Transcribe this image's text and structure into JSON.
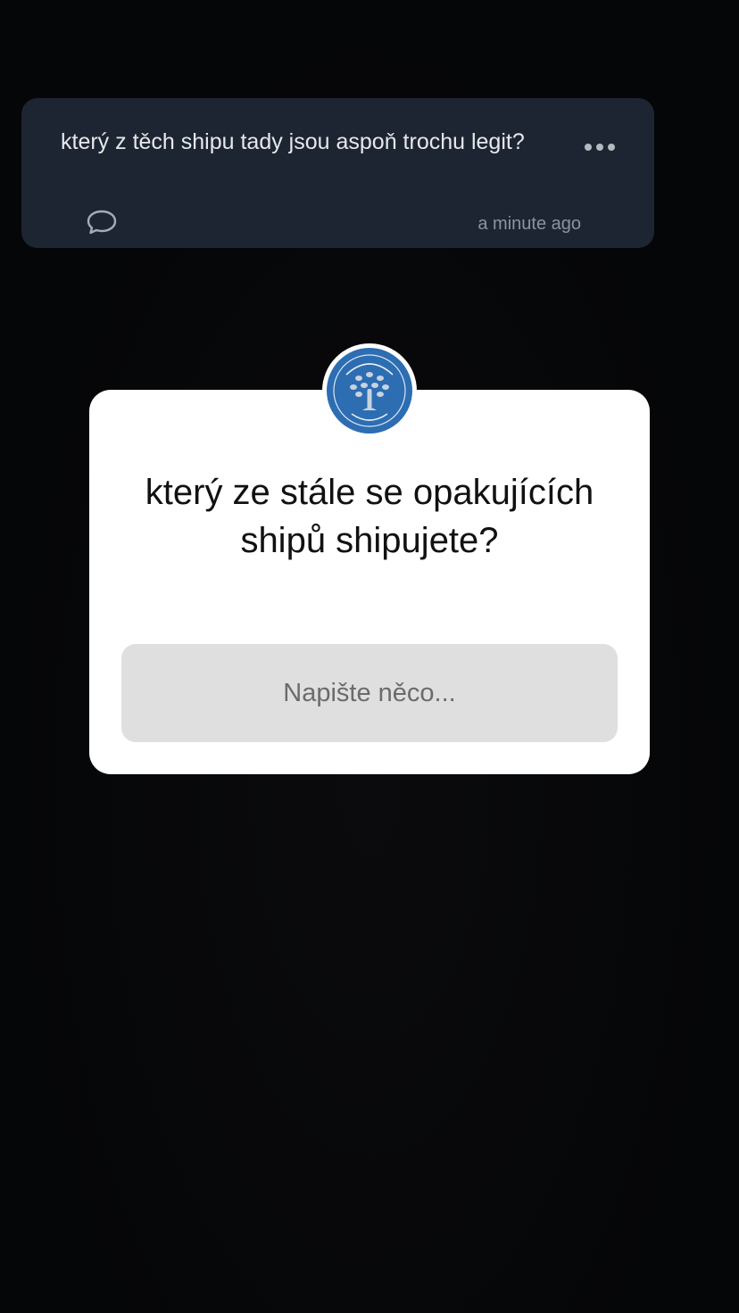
{
  "question_card": {
    "text": "který z těch shipu tady jsou aspoň trochu legit?",
    "timestamp": "a minute ago",
    "more_icon": "more-horizontal-icon",
    "reply_icon": "comment-bubble-icon",
    "background": "#1e2532"
  },
  "sticker": {
    "title": "který ze stále se opakujících shipů shipujete?",
    "input_placeholder": "Napište něco...",
    "avatar_icon": "tree-logo-avatar",
    "avatar_color": "#2d6db2"
  }
}
